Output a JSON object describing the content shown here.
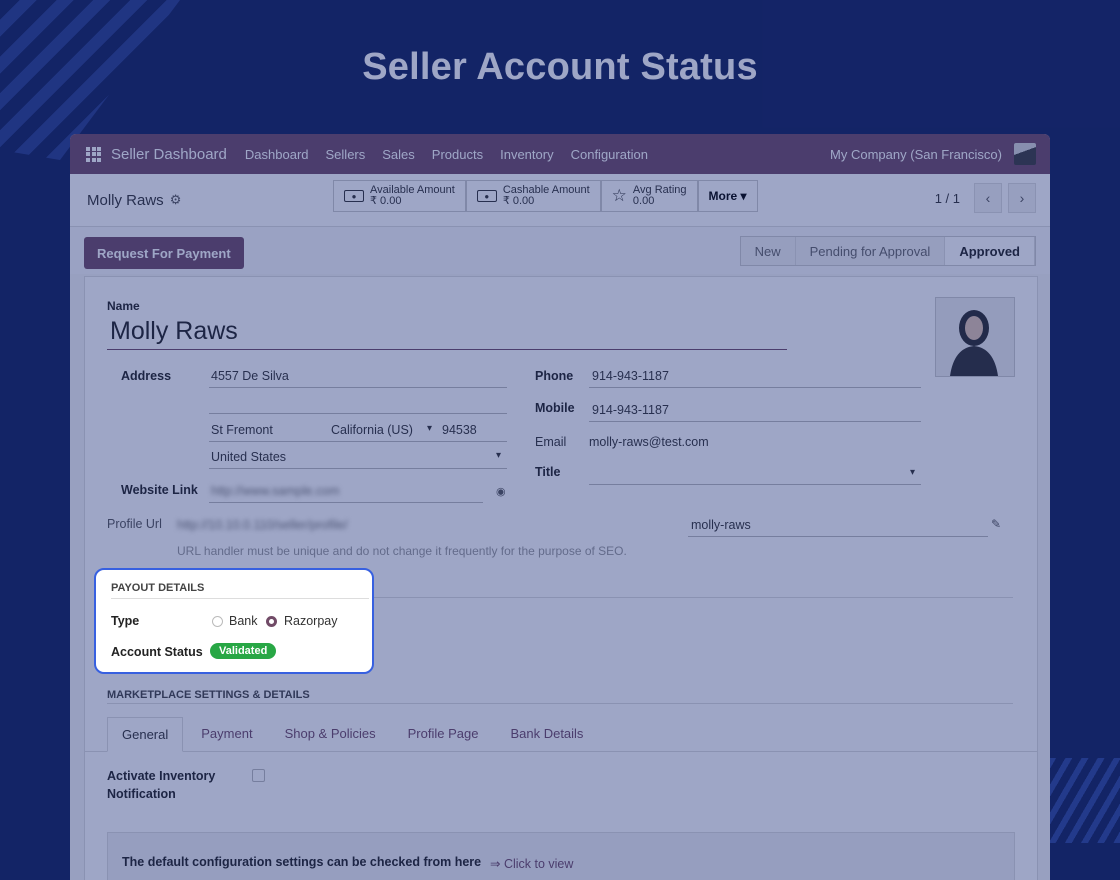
{
  "page_title": "Seller Account Status",
  "topbar": {
    "app_name": "Seller Dashboard",
    "menu": [
      "Dashboard",
      "Sellers",
      "Sales",
      "Products",
      "Inventory",
      "Configuration"
    ],
    "company": "My Company (San Francisco)"
  },
  "control": {
    "record_name": "Molly Raws",
    "available_label": "Available Amount",
    "available_value": "₹ 0.00",
    "cashable_label": "Cashable Amount",
    "cashable_value": "₹ 0.00",
    "rating_label": "Avg Rating",
    "rating_value": "0.00",
    "more_label": "More ▾",
    "pager": "1 / 1"
  },
  "status": {
    "request_button": "Request For Payment",
    "steps": [
      "New",
      "Pending for Approval",
      "Approved"
    ],
    "active_step": "Approved"
  },
  "form": {
    "name_label": "Name",
    "name_value": "Molly Raws",
    "address_label": "Address",
    "street": "4557 De Silva",
    "street2": "",
    "city": "St Fremont",
    "state": "California (US)",
    "zip": "94538",
    "country": "United States",
    "website_label": "Website Link",
    "website_value": "http://www.sample.com",
    "phone_label": "Phone",
    "phone_value": "914-943-1187",
    "mobile_label": "Mobile",
    "mobile_value": "914-943-1187",
    "email_label": "Email",
    "email_value": "molly-raws@test.com",
    "title_label": "Title",
    "title_value": "",
    "profile_url_label": "Profile Url",
    "profile_url_value": "http://10.10.0.110/seller/profile/",
    "profile_slug": "molly-raws",
    "profile_hint": "URL handler must be unique and do not change it frequently for the purpose of SEO."
  },
  "payout": {
    "heading": "PAYOUT DETAILS",
    "type_label": "Type",
    "option_bank": "Bank",
    "option_razorpay": "Razorpay",
    "selected": "Razorpay",
    "account_status_label": "Account Status",
    "account_status_value": "Validated",
    "status_color": "#28a745"
  },
  "marketplace": {
    "heading": "MARKETPLACE SETTINGS & DETAILS",
    "tabs": [
      "General",
      "Payment",
      "Shop & Policies",
      "Profile Page",
      "Bank Details"
    ],
    "active_tab": "General",
    "inventory_label_line1": "Activate Inventory",
    "inventory_label_line2": "Notification",
    "info_text": "The default configuration settings can be checked from here",
    "info_link": "⇒ Click to view"
  },
  "colors": {
    "brand": "#714b67",
    "background": "#11205a",
    "highlight_border": "#3760e0"
  }
}
